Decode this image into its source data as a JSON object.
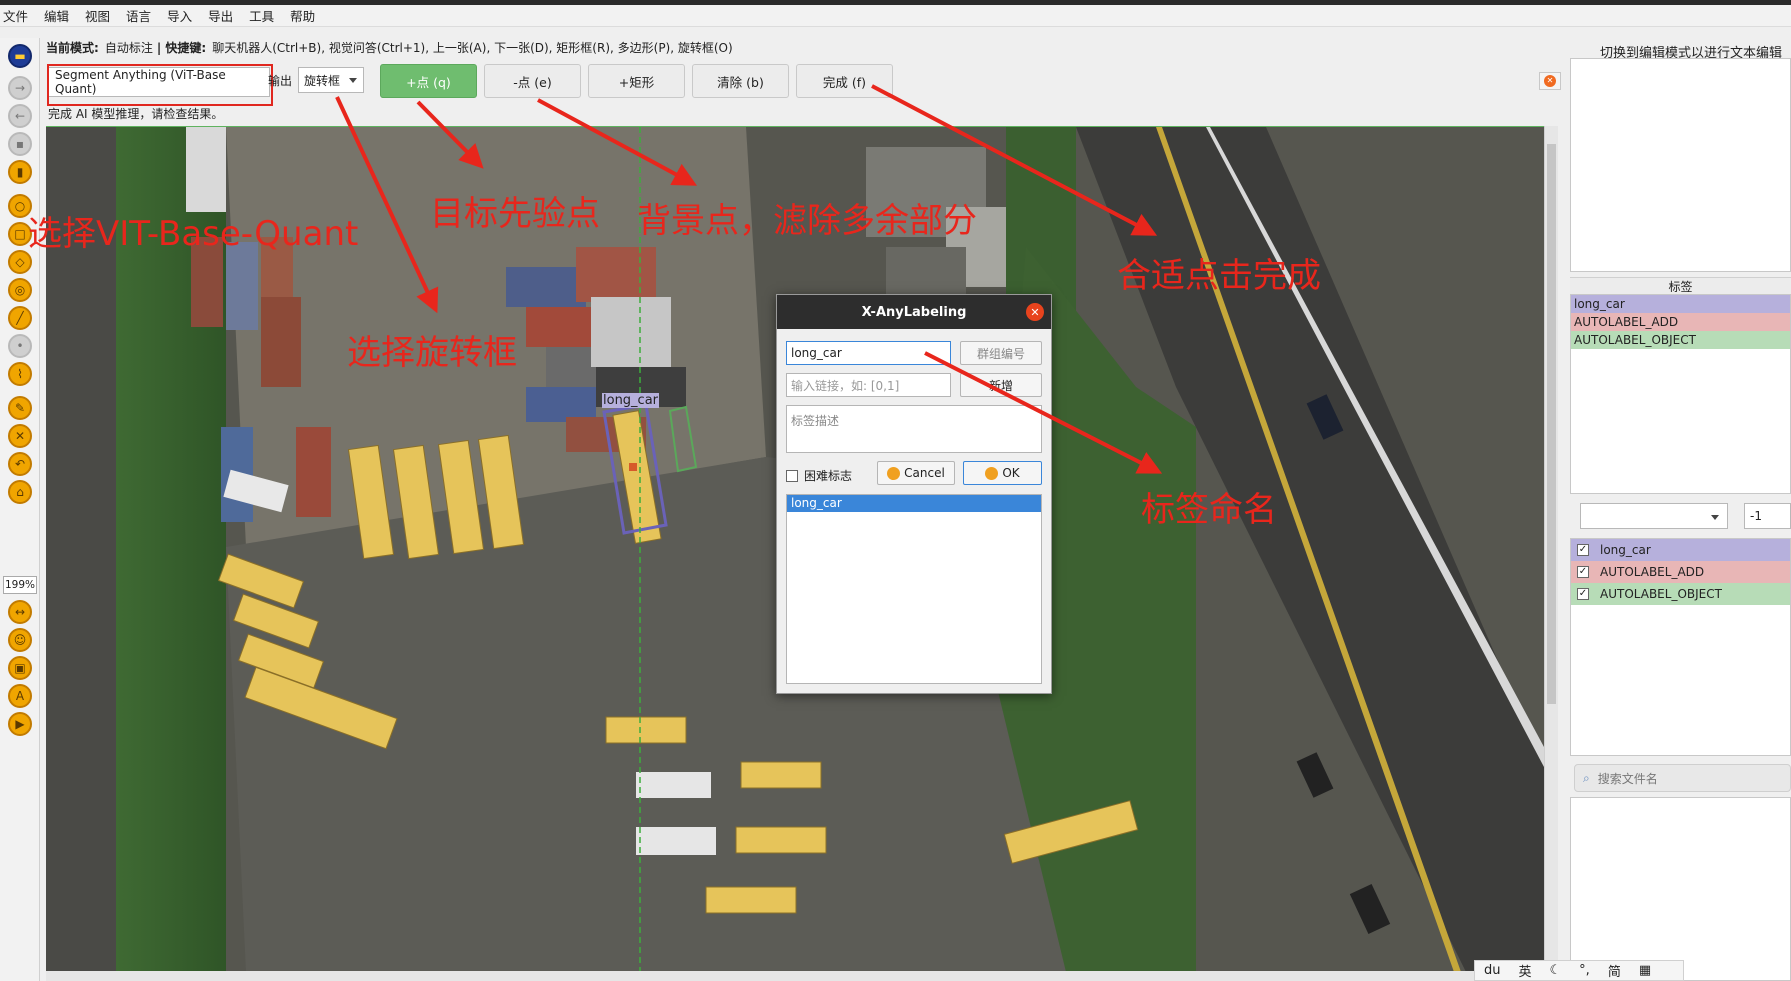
{
  "menu": [
    "文件",
    "编辑",
    "视图",
    "语言",
    "导入",
    "导出",
    "工具",
    "帮助"
  ],
  "toolbar": {
    "zoom": "199%"
  },
  "mode_bar": {
    "mode_label": "当前模式:",
    "mode_value": "自动标注",
    "shortcut_label": "| 快捷键:",
    "shortcuts": "聊天机器人(Ctrl+B), 视觉问答(Ctrl+1), 上一张(A), 下一张(D), 矩形框(R), 多边形(P), 旋转框(O)"
  },
  "controls": {
    "model": "Segment Anything (ViT-Base Quant)",
    "output_label": "输出",
    "output_value": "旋转框",
    "add_point": "+点 (q)",
    "remove_point": "-点 (e)",
    "add_rect": "+矩形",
    "clear": "清除 (b)",
    "finish": "完成 (f)"
  },
  "status": "完成 AI 模型推理，请检查结果。",
  "right_panel": {
    "text_mode_hint": "切换到编辑模式以进行文本编辑",
    "labels_header": "标签",
    "labels": [
      {
        "name": "long_car",
        "color": "#b6b0dc"
      },
      {
        "name": "AUTOLABEL_ADD",
        "color": "#e8b6b6"
      },
      {
        "name": "AUTOLABEL_OBJECT",
        "color": "#b7dcb7"
      }
    ],
    "group_id": "-1",
    "shapes": [
      {
        "name": "long_car",
        "checked": true,
        "color": "#b6b0dc"
      },
      {
        "name": "AUTOLABEL_ADD",
        "checked": true,
        "color": "#e8b6b6"
      },
      {
        "name": "AUTOLABEL_OBJECT",
        "checked": true,
        "color": "#b7dcb7"
      }
    ],
    "search_placeholder": "搜索文件名"
  },
  "canvas": {
    "shape_label": "long_car"
  },
  "dialog": {
    "title": "X-AnyLabeling",
    "label_value": "long_car",
    "group_placeholder": "群组编号",
    "link_placeholder": "输入链接，如: [0,1]",
    "add_button": "新增",
    "description_placeholder": "标签描述",
    "difficult_label": "困难标志",
    "cancel": "Cancel",
    "ok": "OK",
    "label_list": [
      "long_car"
    ]
  },
  "annotations": {
    "select_model": "选择VIT-Base-Quant",
    "positive_point": "目标先验点",
    "negative_point": "背景点，滤除多余部分",
    "finish_hint": "合适点击完成",
    "select_rotation": "选择旋转框",
    "label_naming": "标签命名"
  },
  "ime": [
    "英",
    "简"
  ],
  "colors": {
    "add_point_button": "#6fbd6f",
    "annotation_red": "#e8261c",
    "dialog_selection": "#3a86d9"
  }
}
